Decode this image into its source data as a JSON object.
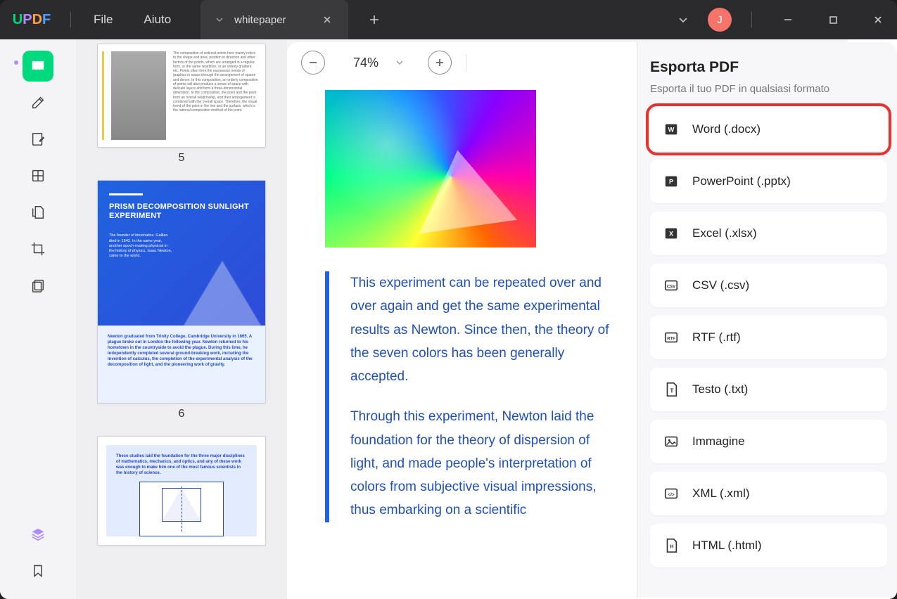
{
  "app": {
    "logo_letters": [
      "U",
      "P",
      "D",
      "F"
    ]
  },
  "menu": {
    "file": "File",
    "help": "Aiuto"
  },
  "tab": {
    "title": "whitepaper"
  },
  "titlebar": {
    "avatar_initial": "J"
  },
  "zoom": {
    "value": "74%"
  },
  "thumbs": {
    "page5_num": "5",
    "page6_num": "6",
    "page6_title": "PRISM DECOMPOSITION SUNLIGHT EXPERIMENT",
    "page6_sub": "The founder of kinematics. Galileo died in 1642. In the same year, another epoch-making physicist in the history of physics, Isaac Newton, came to the world.",
    "page6_bottom": "Newton graduated from Trinity College, Cambridge University in 1665. A plague broke out in London the following year. Newton returned to his hometown in the countryside to avoid the plague. During this time, he independently completed several ground-breaking work, including the invention of calculus, the completion of the experimental analysis of the decomposition of light, and the pioneering work of gravity.",
    "page7_txt": "These studies laid the foundation for the three major disciplines of mathematics, mechanics, and optics, and any of these work was enough to make him one of the most famous scientists in the history of science."
  },
  "document": {
    "para1": "This experiment can be repeated over and over again and get the same experimental results as Newton. Since then, the theory of the seven colors has been generally accepted.",
    "para2": "Through this experiment, Newton laid the foundation for the theory of dispersion of light, and made people's interpretation of colors from subjective visual impressions, thus embarking on a scientific"
  },
  "export_panel": {
    "title": "Esporta PDF",
    "subtitle": "Esporta il tuo PDF in qualsiasi formato",
    "options": [
      {
        "label": "Word (.docx)"
      },
      {
        "label": "PowerPoint (.pptx)"
      },
      {
        "label": "Excel (.xlsx)"
      },
      {
        "label": "CSV (.csv)"
      },
      {
        "label": "RTF (.rtf)"
      },
      {
        "label": "Testo (.txt)"
      },
      {
        "label": "Immagine"
      },
      {
        "label": "XML (.xml)"
      },
      {
        "label": "HTML (.html)"
      }
    ]
  },
  "colors": {
    "accent": "#00d97e",
    "highlight": "#e3342f"
  }
}
